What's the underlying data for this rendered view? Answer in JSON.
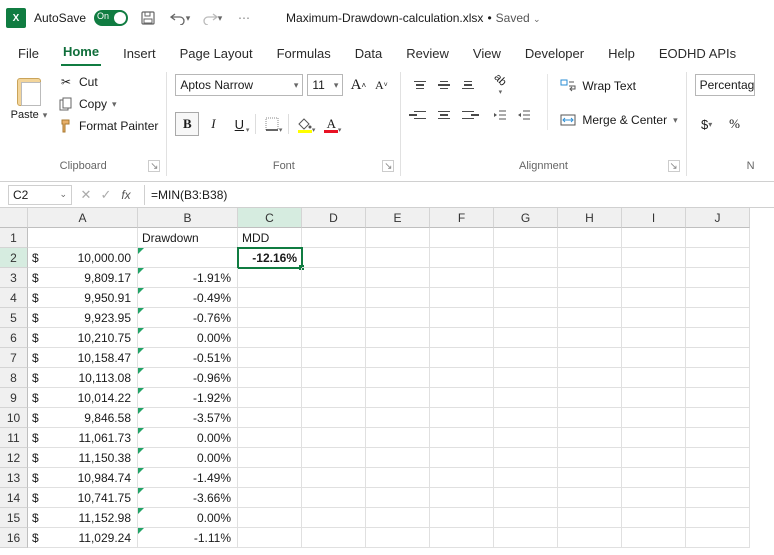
{
  "titlebar": {
    "app_abbrev": "X",
    "autosave_label": "AutoSave",
    "toggle_state": "On",
    "filename": "Maximum-Drawdown-calculation.xlsx",
    "saved_status": "Saved"
  },
  "tabs": {
    "file": "File",
    "home": "Home",
    "insert": "Insert",
    "page_layout": "Page Layout",
    "formulas": "Formulas",
    "data": "Data",
    "review": "Review",
    "view": "View",
    "developer": "Developer",
    "help": "Help",
    "eodhd": "EODHD APIs"
  },
  "ribbon": {
    "clipboard": {
      "label": "Clipboard",
      "paste": "Paste",
      "cut": "Cut",
      "copy": "Copy",
      "fmt_painter": "Format Painter"
    },
    "font": {
      "label": "Font",
      "name": "Aptos Narrow",
      "size": "11",
      "bold": "B",
      "italic": "I",
      "underline": "U"
    },
    "alignment": {
      "label": "Alignment",
      "wrap": "Wrap Text",
      "merge": "Merge & Center"
    },
    "number": {
      "label": "N",
      "format": "Percentag",
      "currency": "$"
    }
  },
  "formula_bar": {
    "name_box": "C2",
    "formula": "=MIN(B3:B38)"
  },
  "columns": [
    "A",
    "B",
    "C",
    "D",
    "E",
    "F",
    "G",
    "H",
    "I",
    "J"
  ],
  "headers": {
    "B": "Drawdown",
    "C": "MDD"
  },
  "selected_cell_value": "-12.16%",
  "rows": [
    {
      "r": 1
    },
    {
      "r": 2,
      "A": "10,000.00",
      "B": "",
      "C": "-12.16%"
    },
    {
      "r": 3,
      "A": "9,809.17",
      "B": "-1.91%"
    },
    {
      "r": 4,
      "A": "9,950.91",
      "B": "-0.49%"
    },
    {
      "r": 5,
      "A": "9,923.95",
      "B": "-0.76%"
    },
    {
      "r": 6,
      "A": "10,210.75",
      "B": "0.00%"
    },
    {
      "r": 7,
      "A": "10,158.47",
      "B": "-0.51%"
    },
    {
      "r": 8,
      "A": "10,113.08",
      "B": "-0.96%"
    },
    {
      "r": 9,
      "A": "10,014.22",
      "B": "-1.92%"
    },
    {
      "r": 10,
      "A": "9,846.58",
      "B": "-3.57%"
    },
    {
      "r": 11,
      "A": "11,061.73",
      "B": "0.00%"
    },
    {
      "r": 12,
      "A": "11,150.38",
      "B": "0.00%"
    },
    {
      "r": 13,
      "A": "10,984.74",
      "B": "-1.49%"
    },
    {
      "r": 14,
      "A": "10,741.75",
      "B": "-3.66%"
    },
    {
      "r": 15,
      "A": "11,152.98",
      "B": "0.00%"
    },
    {
      "r": 16,
      "A": "11,029.24",
      "B": "-1.11%"
    }
  ]
}
